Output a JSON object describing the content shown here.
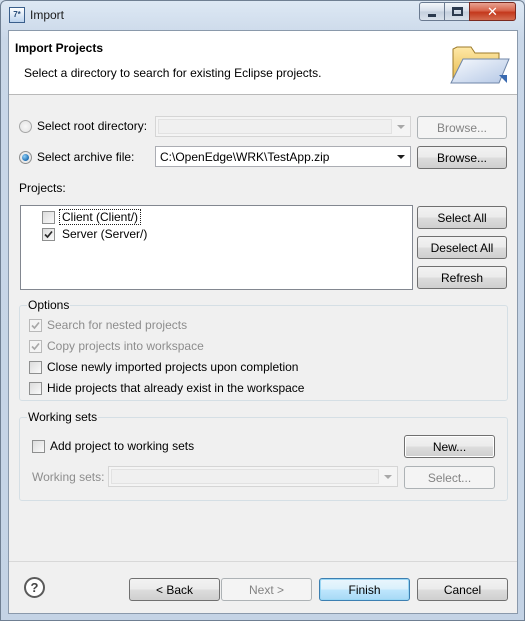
{
  "window": {
    "title": "Import",
    "close_glyph": "✕"
  },
  "banner": {
    "title": "Import Projects",
    "description": "Select a directory to search for existing Eclipse projects."
  },
  "source": {
    "root_dir_label": "Select root directory:",
    "root_dir_value": "",
    "root_browse": "Browse...",
    "archive_label": "Select archive file:",
    "archive_value": "C:\\OpenEdge\\WRK\\TestApp.zip",
    "archive_browse": "Browse...",
    "selected": "archive"
  },
  "projects": {
    "label": "Projects:",
    "items": [
      {
        "label": "Client (Client/)",
        "checked": false
      },
      {
        "label": "Server (Server/)",
        "checked": true
      }
    ],
    "select_all": "Select All",
    "deselect_all": "Deselect All",
    "refresh": "Refresh"
  },
  "options": {
    "title": "Options",
    "items": [
      {
        "label": "Search for nested projects",
        "checked": true,
        "enabled": false
      },
      {
        "label": "Copy projects into workspace",
        "checked": true,
        "enabled": false
      },
      {
        "label": "Close newly imported projects upon completion",
        "checked": false,
        "enabled": true
      },
      {
        "label": "Hide projects that already exist in the workspace",
        "checked": false,
        "enabled": true
      }
    ]
  },
  "working_sets": {
    "title": "Working sets",
    "add_label": "Add project to working sets",
    "add_checked": false,
    "new_button": "New...",
    "sets_label": "Working sets:",
    "sets_value": "",
    "select_button": "Select..."
  },
  "footer": {
    "help": "?",
    "back": "< Back",
    "next": "Next >",
    "finish": "Finish",
    "cancel": "Cancel"
  }
}
